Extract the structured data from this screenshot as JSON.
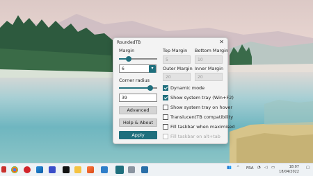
{
  "window": {
    "title": "RoundedTB",
    "close_glyph": "✕"
  },
  "margin": {
    "label": "Margin",
    "value": "6",
    "slider_level": 0.18,
    "dropdown_glyph": "▾"
  },
  "corner_radius": {
    "label": "Corner radius",
    "value": "39",
    "slider_level": 0.82
  },
  "top_margin": {
    "label": "Top Margin",
    "value": "5"
  },
  "bottom_margin": {
    "label": "Bottom Margin",
    "value": "10"
  },
  "outer_margin": {
    "label": "Outer Margin",
    "value": "20"
  },
  "inner_margin": {
    "label": "Inner Margin",
    "value": "20"
  },
  "buttons": {
    "advanced": "Advanced",
    "help": "Help & About",
    "apply": "Apply"
  },
  "options": [
    {
      "label": "Dynamic mode",
      "checked": true,
      "disabled": false
    },
    {
      "label": "Show system tray (Win+F2)",
      "checked": true,
      "disabled": false
    },
    {
      "label": "Show system tray on hover",
      "checked": false,
      "disabled": false
    },
    {
      "label": "TranslucentTB compatibility",
      "checked": false,
      "disabled": false
    },
    {
      "label": "Fill taskbar when maximised",
      "checked": false,
      "disabled": false
    },
    {
      "label": "Fill taskbar on alt+tab",
      "checked": false,
      "disabled": true
    }
  ],
  "taskbar": {
    "language": "FRA",
    "time": "18:07",
    "date": "18/04/2022",
    "colors": {
      "accent": "#1f6f7d"
    }
  }
}
